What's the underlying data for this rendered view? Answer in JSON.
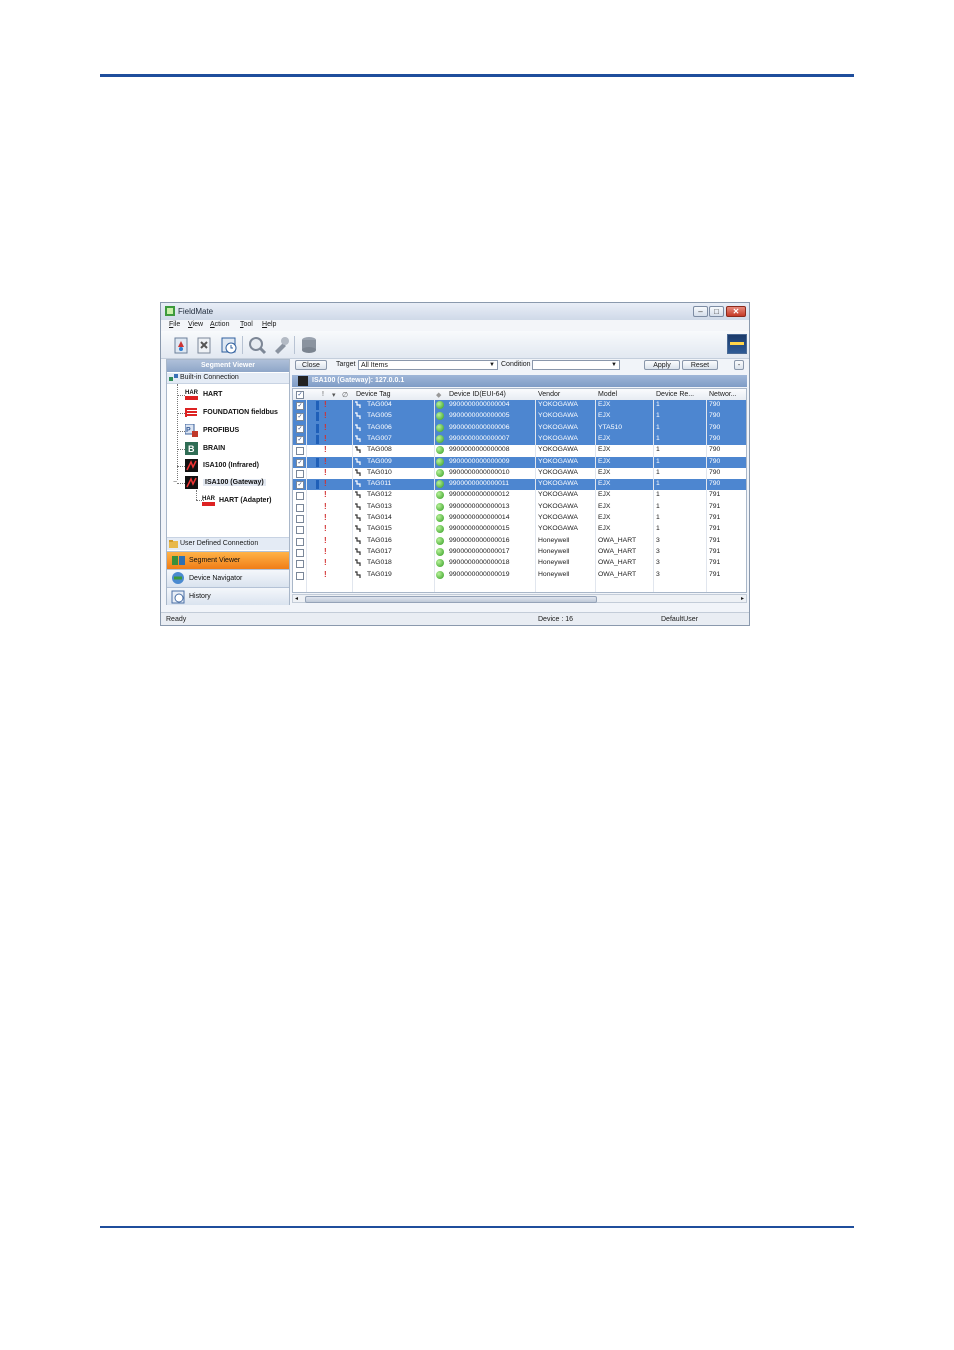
{
  "window": {
    "title": "FieldMate",
    "controls": {
      "minimize": "–",
      "maximize": "□",
      "close": "✕"
    }
  },
  "menu": [
    "File",
    "View",
    "Action",
    "Tool",
    "Help"
  ],
  "left_panel": {
    "header": "Segment Viewer",
    "builtin_label": "Built-in Connection",
    "tree": [
      {
        "label": "HART",
        "icon": "hart-icon"
      },
      {
        "label": "FOUNDATION fieldbus",
        "icon": "foundation-fieldbus-icon"
      },
      {
        "label": "PROFIBUS",
        "icon": "profibus-icon"
      },
      {
        "label": "BRAIN",
        "icon": "brain-icon"
      },
      {
        "label": "ISA100 (Infrared)",
        "icon": "isa100-icon"
      },
      {
        "label": "ISA100 (Gateway)",
        "icon": "isa100-icon"
      },
      {
        "label": "HART (Adapter)",
        "icon": "hart-icon"
      }
    ],
    "user_defined": "User Defined Connection",
    "nav": [
      "Segment Viewer",
      "Device Navigator",
      "History"
    ]
  },
  "filter": {
    "close": "Close",
    "target_label": "Target",
    "target_value": "All Items",
    "condition_label": "Condition",
    "condition_value": "",
    "apply": "Apply",
    "reset": "Reset"
  },
  "segment_header": "ISA100 (Gateway): 127.0.0.1",
  "grid": {
    "columns": [
      "Device Tag",
      "Device ID(EUI-64)",
      "Vendor",
      "Model",
      "Device Re...",
      "Networ..."
    ],
    "rows": [
      {
        "tag": "TAG004",
        "id": "9900000000000004",
        "vendor": "YOKOGAWA",
        "model": "EJX",
        "rev": "1",
        "net": "790",
        "checked": true,
        "selected": true
      },
      {
        "tag": "TAG005",
        "id": "9900000000000005",
        "vendor": "YOKOGAWA",
        "model": "EJX",
        "rev": "1",
        "net": "790",
        "checked": true,
        "selected": true
      },
      {
        "tag": "TAG006",
        "id": "9900000000000006",
        "vendor": "YOKOGAWA",
        "model": "YTA510",
        "rev": "1",
        "net": "790",
        "checked": true,
        "selected": true
      },
      {
        "tag": "TAG007",
        "id": "9900000000000007",
        "vendor": "YOKOGAWA",
        "model": "EJX",
        "rev": "1",
        "net": "790",
        "checked": true,
        "selected": true
      },
      {
        "tag": "TAG008",
        "id": "9900000000000008",
        "vendor": "YOKOGAWA",
        "model": "EJX",
        "rev": "1",
        "net": "790",
        "checked": false,
        "selected": false
      },
      {
        "tag": "TAG009",
        "id": "9900000000000009",
        "vendor": "YOKOGAWA",
        "model": "EJX",
        "rev": "1",
        "net": "790",
        "checked": true,
        "selected": true
      },
      {
        "tag": "TAG010",
        "id": "9900000000000010",
        "vendor": "YOKOGAWA",
        "model": "EJX",
        "rev": "1",
        "net": "790",
        "checked": false,
        "selected": false
      },
      {
        "tag": "TAG011",
        "id": "9900000000000011",
        "vendor": "YOKOGAWA",
        "model": "EJX",
        "rev": "1",
        "net": "790",
        "checked": true,
        "selected": true
      },
      {
        "tag": "TAG012",
        "id": "9900000000000012",
        "vendor": "YOKOGAWA",
        "model": "EJX",
        "rev": "1",
        "net": "791",
        "checked": false,
        "selected": false
      },
      {
        "tag": "TAG013",
        "id": "9900000000000013",
        "vendor": "YOKOGAWA",
        "model": "EJX",
        "rev": "1",
        "net": "791",
        "checked": false,
        "selected": false
      },
      {
        "tag": "TAG014",
        "id": "9900000000000014",
        "vendor": "YOKOGAWA",
        "model": "EJX",
        "rev": "1",
        "net": "791",
        "checked": false,
        "selected": false
      },
      {
        "tag": "TAG015",
        "id": "9900000000000015",
        "vendor": "YOKOGAWA",
        "model": "EJX",
        "rev": "1",
        "net": "791",
        "checked": false,
        "selected": false
      },
      {
        "tag": "TAG016",
        "id": "9900000000000016",
        "vendor": "Honeywell",
        "model": "OWA_HART",
        "rev": "3",
        "net": "791",
        "checked": false,
        "selected": false
      },
      {
        "tag": "TAG017",
        "id": "9900000000000017",
        "vendor": "Honeywell",
        "model": "OWA_HART",
        "rev": "3",
        "net": "791",
        "checked": false,
        "selected": false
      },
      {
        "tag": "TAG018",
        "id": "9900000000000018",
        "vendor": "Honeywell",
        "model": "OWA_HART",
        "rev": "3",
        "net": "791",
        "checked": false,
        "selected": false
      },
      {
        "tag": "TAG019",
        "id": "9900000000000019",
        "vendor": "Honeywell",
        "model": "OWA_HART",
        "rev": "3",
        "net": "791",
        "checked": false,
        "selected": false
      }
    ]
  },
  "status": {
    "left": "Ready",
    "device": "Device : 16",
    "user": "DefaultUser"
  },
  "colors": {
    "selection": "#4d86d0",
    "rule": "#1f4e9c",
    "accent": "#f07d18"
  }
}
